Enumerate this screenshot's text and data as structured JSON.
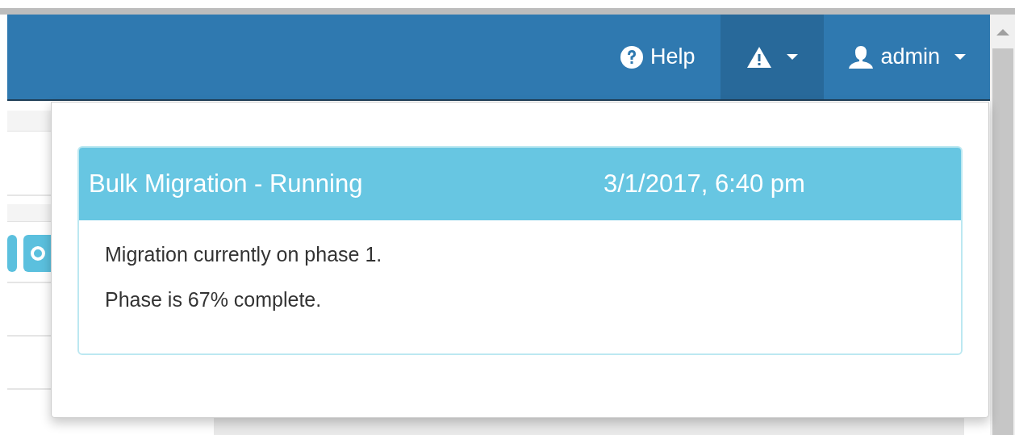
{
  "navbar": {
    "items": [
      {
        "kind": "help",
        "label": "Help",
        "expanded": false
      },
      {
        "kind": "alerts",
        "expanded": true
      },
      {
        "kind": "user",
        "label": "admin",
        "expanded": false
      }
    ]
  },
  "notifications": [
    {
      "title": "Bulk Migration - Running",
      "time": "3/1/2017, 6:40 pm",
      "lines": [
        "Migration currently on phase 1.",
        "Phase is 67% complete."
      ]
    }
  ]
}
